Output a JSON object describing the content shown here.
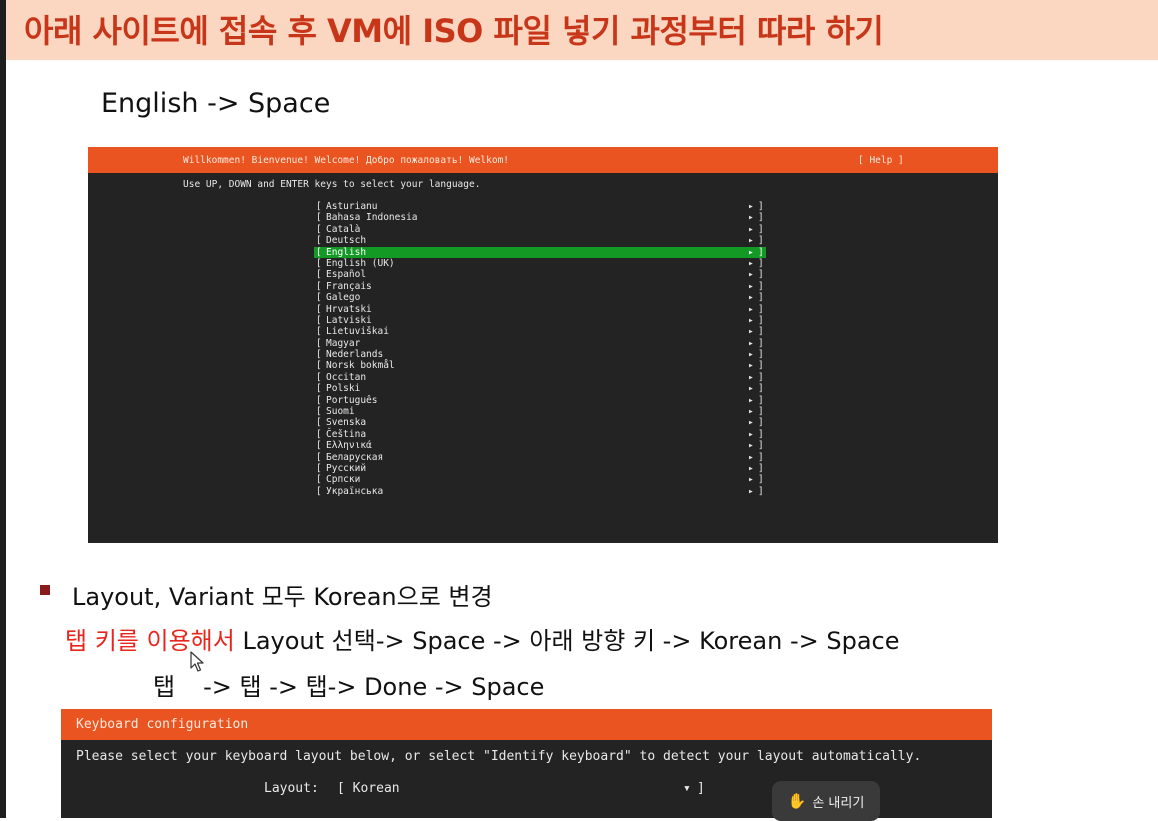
{
  "slide": {
    "title": "아래 사이트에 접속 후 VM에 ISO 파일 넣기 과정부터 따라 하기",
    "subheading": "English -> Space"
  },
  "language_screen": {
    "welcome": "Willkommen! Bienvenue! Welcome! Добро пожаловать! Welkom!",
    "help": "[ Help ]",
    "instruction": "Use UP, DOWN and ENTER keys to select your language.",
    "bracket_open": "[",
    "bracket_close": "]",
    "arrow": "▸",
    "selected": "English",
    "languages": [
      "Asturianu",
      "Bahasa Indonesia",
      "Català",
      "Deutsch",
      "English",
      "English (UK)",
      "Español",
      "Français",
      "Galego",
      "Hrvatski",
      "Latviski",
      "Lietuviškai",
      "Magyar",
      "Nederlands",
      "Norsk bokmål",
      "Occitan",
      "Polski",
      "Português",
      "Suomi",
      "Svenska",
      "Čeština",
      "Ελληνικά",
      "Беларуская",
      "Русский",
      "Српски",
      "Українська"
    ]
  },
  "notes": {
    "bullet": "Layout, Variant 모두 Korean으로 변경",
    "line1_red": "탭 키를 이용해서",
    "line1_rest": " Layout 선택-> Space ->  아래 방향 키 ->   Korean -> Space",
    "line2_a": "탭",
    "line2_b": "->  탭 -> 탭-> Done -> Space"
  },
  "keyboard_screen": {
    "title": "Keyboard configuration",
    "description": "Please select your keyboard layout below, or select \"Identify keyboard\" to detect your layout automatically.",
    "layout_label": "Layout:",
    "layout_value": "[ Korean",
    "dropdown_arrow": "▾",
    "close_bracket": "]"
  },
  "raise_hand": {
    "label": "손 내리기",
    "icon": "hand-icon"
  },
  "colors": {
    "title": "#c8361a",
    "title_bg": "#fbd6c0",
    "ubuntu_orange": "#e95420",
    "selection_green": "#139a25",
    "accent_red": "#e8261e"
  }
}
